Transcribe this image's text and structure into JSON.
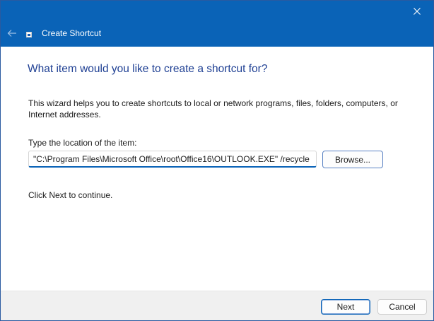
{
  "window": {
    "title": "Create Shortcut",
    "accent_color": "#0a63b7"
  },
  "titlebar": {
    "close_icon": "close-icon",
    "back_icon": "back-arrow-icon",
    "app_icon": "shortcut-icon"
  },
  "main": {
    "heading": "What item would you like to create a shortcut for?",
    "intro": "This wizard helps you to create shortcuts to local or network programs, files, folders, computers, or Internet addresses.",
    "location_label": "Type the location of the item:",
    "location_value": "\"C:\\Program Files\\Microsoft Office\\root\\Office16\\OUTLOOK.EXE\" /recycle",
    "browse_label": "Browse...",
    "continue_text": "Click Next to continue."
  },
  "footer": {
    "next_label": "Next",
    "cancel_label": "Cancel"
  }
}
